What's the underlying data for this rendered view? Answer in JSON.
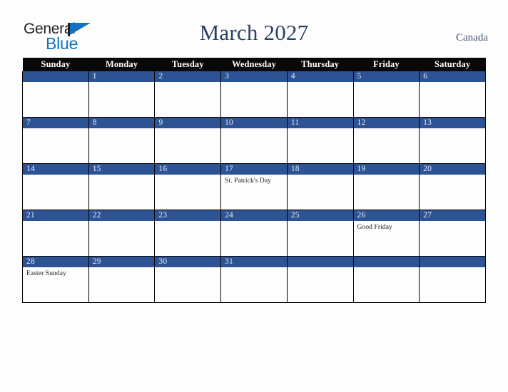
{
  "brand": {
    "name_part1": "General",
    "name_part2": "Blue",
    "triangle_color": "#1272bd",
    "text_color": "#231f20"
  },
  "header": {
    "title": "March 2027",
    "title_color": "#2b4164",
    "country": "Canada"
  },
  "colors": {
    "header_row_bg": "#080808",
    "day_bar_bg": "#2e5395",
    "day_number_text": "#e8ecf4",
    "cell_bg": "#fdfdfd",
    "page_bg": "#fdfdfd",
    "grid_line": "#000000"
  },
  "calendar": {
    "month": "March",
    "year": "2027",
    "weekday_headers": [
      "Sunday",
      "Monday",
      "Tuesday",
      "Wednesday",
      "Thursday",
      "Friday",
      "Saturday"
    ],
    "weeks": [
      [
        {
          "day": "",
          "event": ""
        },
        {
          "day": "1",
          "event": ""
        },
        {
          "day": "2",
          "event": ""
        },
        {
          "day": "3",
          "event": ""
        },
        {
          "day": "4",
          "event": ""
        },
        {
          "day": "5",
          "event": ""
        },
        {
          "day": "6",
          "event": ""
        }
      ],
      [
        {
          "day": "7",
          "event": ""
        },
        {
          "day": "8",
          "event": ""
        },
        {
          "day": "9",
          "event": ""
        },
        {
          "day": "10",
          "event": ""
        },
        {
          "day": "11",
          "event": ""
        },
        {
          "day": "12",
          "event": ""
        },
        {
          "day": "13",
          "event": ""
        }
      ],
      [
        {
          "day": "14",
          "event": ""
        },
        {
          "day": "15",
          "event": ""
        },
        {
          "day": "16",
          "event": ""
        },
        {
          "day": "17",
          "event": "St. Patrick's Day"
        },
        {
          "day": "18",
          "event": ""
        },
        {
          "day": "19",
          "event": ""
        },
        {
          "day": "20",
          "event": ""
        }
      ],
      [
        {
          "day": "21",
          "event": ""
        },
        {
          "day": "22",
          "event": ""
        },
        {
          "day": "23",
          "event": ""
        },
        {
          "day": "24",
          "event": ""
        },
        {
          "day": "25",
          "event": ""
        },
        {
          "day": "26",
          "event": "Good Friday"
        },
        {
          "day": "27",
          "event": ""
        }
      ],
      [
        {
          "day": "28",
          "event": "Easter Sunday"
        },
        {
          "day": "29",
          "event": ""
        },
        {
          "day": "30",
          "event": ""
        },
        {
          "day": "31",
          "event": ""
        },
        {
          "day": "",
          "event": ""
        },
        {
          "day": "",
          "event": ""
        },
        {
          "day": "",
          "event": ""
        }
      ]
    ]
  }
}
